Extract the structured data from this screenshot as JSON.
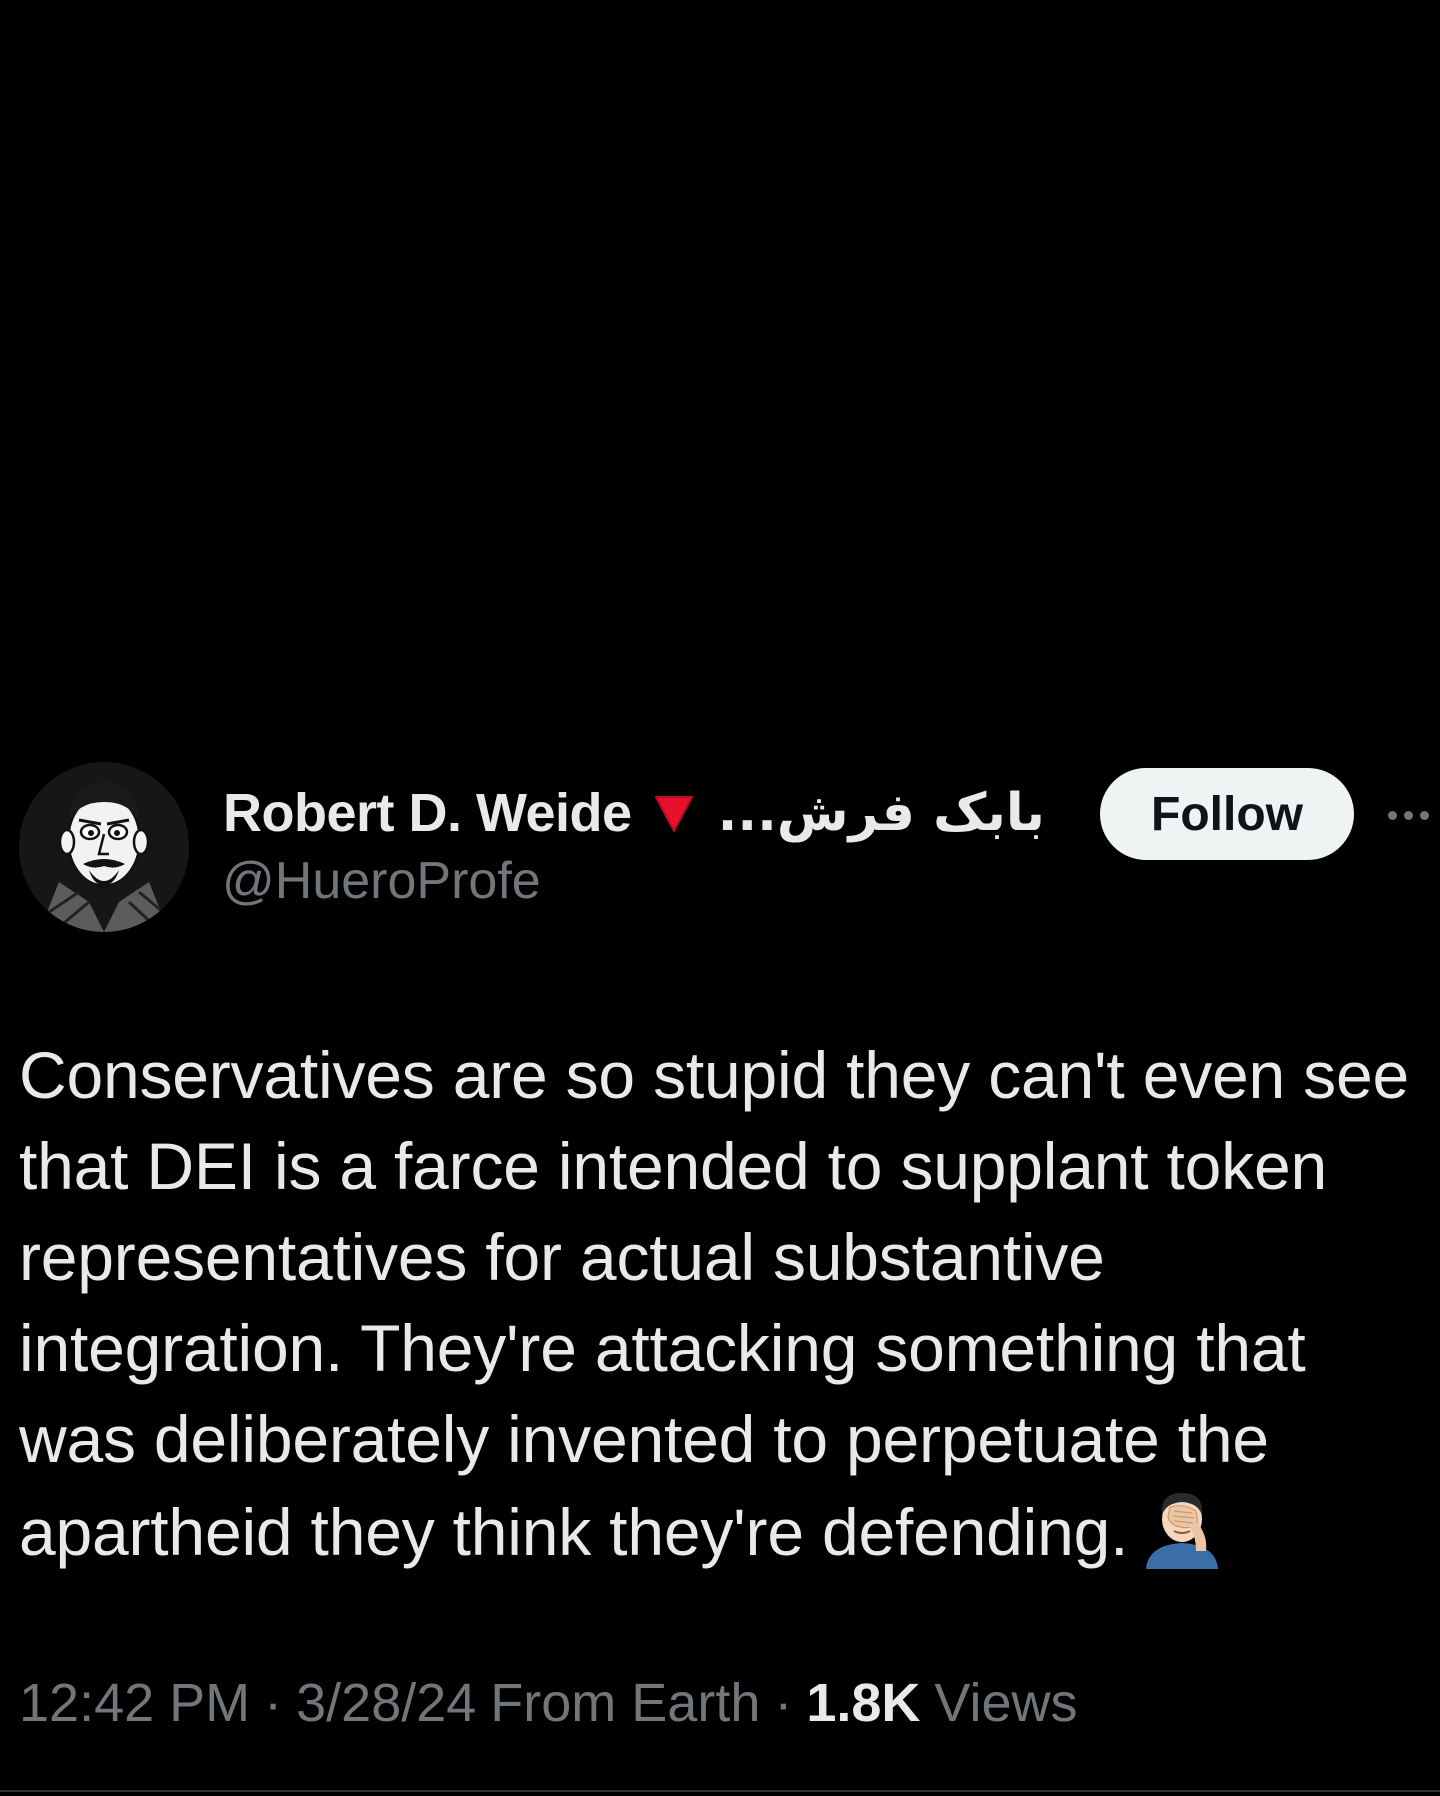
{
  "tweet": {
    "author": {
      "display_name": "Robert D. Weide",
      "flag_icon": "red-triangle-icon",
      "secondary_name": "بابک فرش...",
      "handle": "@HueroProfe",
      "avatar_icon": "cartoon-portrait-avatar"
    },
    "follow_label": "Follow",
    "more_icon": "ellipsis-icon",
    "text": "Conservatives are so stupid they can't even see\nthat DEI is a farce intended to supplant token\nrepresentatives for actual substantive\nintegration. They're attacking something that\nwas deliberately invented to perpetuate the\napartheid they think they're defending.",
    "trailing_emoji_icon": "facepalm-emoji",
    "time": "12:42 PM",
    "date": "3/28/24",
    "source": "From Earth",
    "views_count": "1.8K",
    "views_label": "Views",
    "separator": "·"
  },
  "colors": {
    "background": "#000000",
    "primary_text": "#e7e9ea",
    "secondary_text": "#71767b",
    "follow_bg": "#eff3f4",
    "follow_text": "#0f1419",
    "flag_red": "#e8112d",
    "divider": "#2f3336"
  }
}
